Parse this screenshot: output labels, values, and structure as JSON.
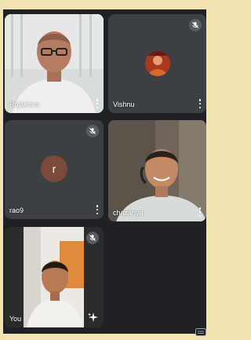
{
  "participants": [
    {
      "name": "Rojakiran"
    },
    {
      "name": "Vishnu"
    },
    {
      "name": "rao9",
      "initial": "r"
    },
    {
      "name": "chaitanya"
    },
    {
      "name": "You"
    }
  ],
  "colors": {
    "background": "#f3e3b0",
    "tile": "#3c4043",
    "avatar_r": "#7b4a3a"
  }
}
